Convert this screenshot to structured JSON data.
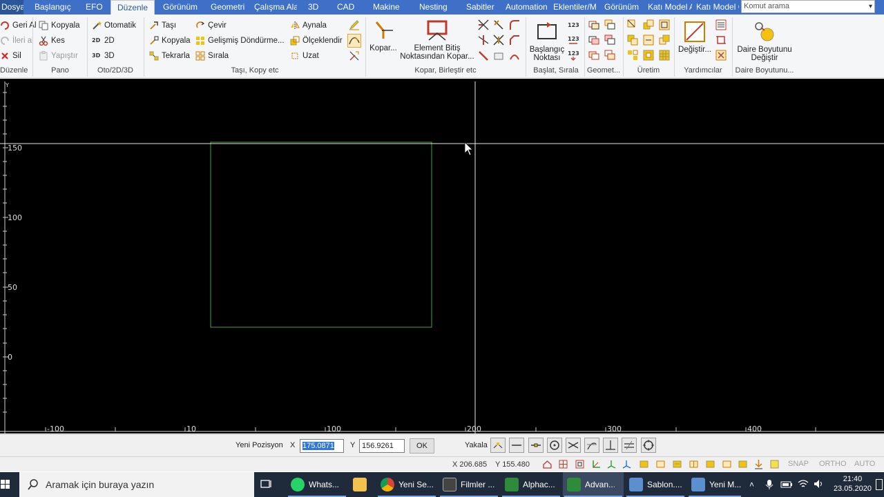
{
  "tabs": [
    "Dosya",
    "Başlangıç",
    "EFO",
    "Düzenle",
    "Görünüm",
    "Geometri",
    "Çalışma Ala",
    "3D",
    "CAD",
    "Makine",
    "Nesting",
    "Sabitler",
    "Automation",
    "Eklentiler/M",
    "Görünüm",
    "Katı Model A",
    "Katı Model G"
  ],
  "active_tab": "Düzenle",
  "search": {
    "placeholder": "Komut arama"
  },
  "ribbon": {
    "duzenle": {
      "label": "Düzenle",
      "geri_al": "Geri Al",
      "ileri_al": "İleri al",
      "sil": "Sil"
    },
    "pano": {
      "label": "Pano",
      "kopyala": "Kopyala",
      "kes": "Kes",
      "yapistir": "Yapıştır"
    },
    "oto": {
      "label": "Oto/2D/3D",
      "otomatik": "Otomatik",
      "d2": "2D",
      "d3": "3D"
    },
    "tasi": {
      "label": "Taşı, Kopy etc",
      "tasi": "Taşı",
      "kopyala": "Kopyala",
      "tekrarla": "Tekrarla",
      "cevir": "Çevir",
      "gelismis": "Gelişmiş Döndürme...",
      "sirala": "Sırala",
      "aynala": "Aynala",
      "olceklendir": "Ölçeklendir",
      "uzat": "Uzat"
    },
    "kopar": {
      "label": "Kopar, Birleştir etc",
      "kopar_btn": "Kopar...",
      "element_l1": "Element Bitiş",
      "element_l2": "Noktasından Kopar..."
    },
    "baslat": {
      "label": "Başlat, Sırala",
      "bas_l1": "Başlangıç",
      "bas_l2": "Noktası"
    },
    "geomet": {
      "label": "Geomet..."
    },
    "uretim": {
      "label": "Üretim"
    },
    "yardim": {
      "label": "Yardımcılar",
      "degistir": "Değiştir..."
    },
    "daire": {
      "label": "Daire Boyutunu...",
      "l1": "Daire Boyutunu",
      "l2": "Değiştir"
    }
  },
  "canvas": {
    "y_axis_label": "Y",
    "y_ticks": [
      "150",
      "100",
      "50",
      "0"
    ],
    "x_ticks": [
      "-100",
      "10",
      "100",
      "200",
      "300",
      "400"
    ]
  },
  "position_bar": {
    "label": "Yeni Pozisyon",
    "x_label": "X",
    "x_value": "175.0871",
    "y_label": "Y",
    "y_value": "156.9261",
    "ok": "OK",
    "snap_label": "Yakala"
  },
  "status": {
    "x": "X 206.685",
    "y": "Y 155.480",
    "snap": "SNAP",
    "ortho": "ORTHO",
    "auto": "AUTO"
  },
  "taskbar": {
    "search_placeholder": "Aramak için buraya yazın",
    "items": [
      "Whats...",
      "",
      "Yeni Se...",
      "Filmler ...",
      "Alphac...",
      "Advan...",
      "Sablon....",
      "Yeni M..."
    ],
    "time": "21:40",
    "date": "23.05.2020"
  },
  "colors": {
    "tabbar": "#3d70c6",
    "canvas": "#000000",
    "rectangle": "#3fa43f",
    "crosshair": "#e8e8e8"
  }
}
